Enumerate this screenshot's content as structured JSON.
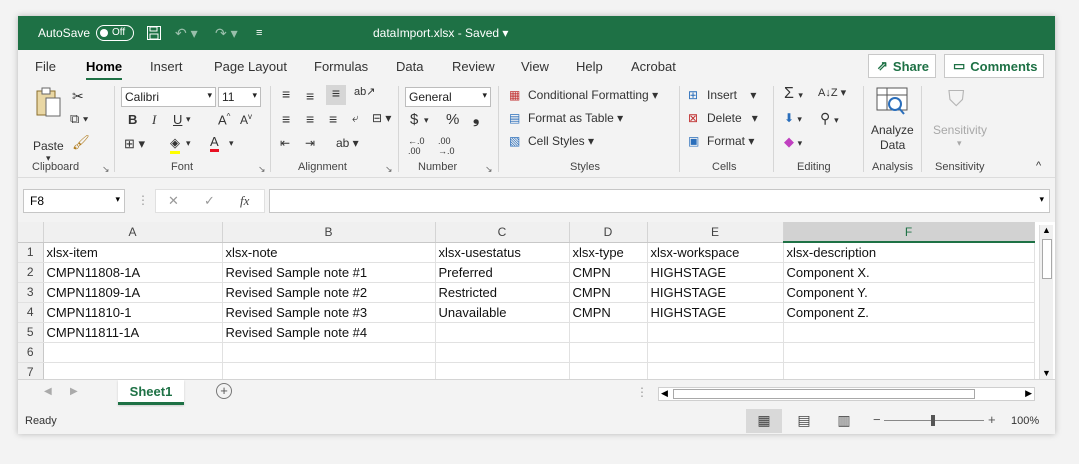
{
  "titlebar": {
    "autosave_label": "AutoSave",
    "autosave_state": "Off",
    "document_title": "dataImport.xlsx  -  Saved  ▾"
  },
  "tabs": [
    "File",
    "Home",
    "Insert",
    "Page Layout",
    "Formulas",
    "Data",
    "Review",
    "View",
    "Help",
    "Acrobat"
  ],
  "active_tab": "Home",
  "share_label": "Share",
  "comments_label": "Comments",
  "ribbon": {
    "clipboard": {
      "paste": "Paste",
      "label": "Clipboard"
    },
    "font": {
      "name": "Calibri",
      "size": "11",
      "label": "Font",
      "bold": "B",
      "italic": "I",
      "underline": "U"
    },
    "alignment": {
      "label": "Alignment"
    },
    "number": {
      "format": "General",
      "label": "Number",
      "currency": "$",
      "percent": "%"
    },
    "styles": {
      "conditional": "Conditional Formatting",
      "format_table": "Format as Table",
      "cell_styles": "Cell Styles",
      "label": "Styles"
    },
    "cells": {
      "insert": "Insert",
      "delete": "Delete",
      "format": "Format",
      "label": "Cells"
    },
    "editing": {
      "label": "Editing"
    },
    "analysis": {
      "analyze_line1": "Analyze",
      "analyze_line2": "Data",
      "label": "Analysis"
    },
    "sensitivity": {
      "button": "Sensitivity",
      "label": "Sensitivity"
    }
  },
  "formula_bar": {
    "name_box": "F8",
    "fx": "fx",
    "content": ""
  },
  "columns": [
    "A",
    "B",
    "C",
    "D",
    "E",
    "F"
  ],
  "selected_column": "F",
  "rows": [
    {
      "n": "1",
      "cells": [
        "xlsx-item",
        "xlsx-note",
        "xlsx-usestatus",
        "xlsx-type",
        "xlsx-workspace",
        "xlsx-description"
      ]
    },
    {
      "n": "2",
      "cells": [
        "CMPN11808-1A",
        "Revised Sample note #1",
        "Preferred",
        "CMPN",
        "HIGHSTAGE",
        "Component X."
      ]
    },
    {
      "n": "3",
      "cells": [
        "CMPN11809-1A",
        "Revised Sample note #2",
        "Restricted",
        "CMPN",
        "HIGHSTAGE",
        "Component Y."
      ]
    },
    {
      "n": "4",
      "cells": [
        "CMPN11810-1",
        "Revised Sample note #3",
        "Unavailable",
        "CMPN",
        "HIGHSTAGE",
        "Component Z."
      ]
    },
    {
      "n": "5",
      "cells": [
        "CMPN11811-1A",
        "Revised Sample note #4",
        "",
        "",
        "",
        ""
      ]
    },
    {
      "n": "6",
      "cells": [
        "",
        "",
        "",
        "",
        "",
        ""
      ]
    },
    {
      "n": "7",
      "cells": [
        "",
        "",
        "",
        "",
        "",
        ""
      ]
    }
  ],
  "sheet_tab": "Sheet1",
  "status": {
    "ready": "Ready",
    "zoom": "100%"
  },
  "colors": {
    "accent": "#1e7145"
  }
}
